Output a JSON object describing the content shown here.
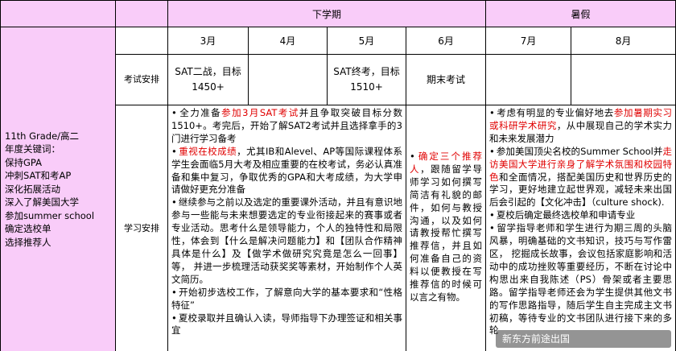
{
  "header": {
    "corner": "",
    "term1": "下学期",
    "term2": "暑假"
  },
  "months": [
    "3月",
    "4月",
    "5月",
    "6月",
    "7月",
    "8月"
  ],
  "row_labels": {
    "exam": "考试安排",
    "study": "学习安排"
  },
  "side": {
    "lines": [
      "11th Grade/高二",
      "年度关键词：",
      "保持GPA",
      "冲刺SAT和考AP",
      "深化拓展活动",
      "深入了解美国大学",
      "参加summer school",
      "确定选校单",
      "选择推荐人"
    ]
  },
  "exam": {
    "march_april": [
      "SAT二战，目标",
      "1450+"
    ],
    "may": [
      "SAT终考，目标",
      "1510+"
    ],
    "june": "期末考试"
  },
  "study": {
    "left": {
      "b1_pre": "全力准备",
      "b1_red": "参加3月SAT考试",
      "b1_post": "并且争取突破目标分数1510+。考完后，开始了解SAT2考试并且选择拿手的3门进行学习备考",
      "b2_red": "重视在校成绩",
      "b2_post": "，尤其IB和Alevel、AP等国际课程体系学生会面临5月大考及相应重要的在校考试，务必认真准备和集中复习，争取优秀的GPA和大考成绩，为大学申请做好更充分准备",
      "b3": "继续参与之前以及选定的重要课外活动，并且有意识地参与一些能与未来想要选定的专业衔接起来的赛事或者专业活动。思考什么是领导能力，个人的独特性和局限性，体会到【什么是解决问题能力】和【团队合作精神具体是什么】及【做学术做研究究竟是怎么一回事】等， 并进一步梳理活动获奖奖等素材，开始制作个人英文简历。",
      "b4": "开始初步选校工作，了解意向大学的基本要求和“性格特征”",
      "b5": "夏校录取并且确认入读，导师指导下办理签证和相关事宜"
    },
    "june": {
      "red": "确定三个推荐人",
      "post": "，跟随留学导师学习如何撰写简洁有礼貌的邮件，如何与教授沟通，以及如何请教授帮忙撰写推荐信，并且如何准备自己的资料以便教授在写推荐信的时候可以言之有物。"
    },
    "summer": {
      "b1_pre": "考虑有明显的专业偏好地去",
      "b1_red": "参加暑期实习或科研学术研究",
      "b1_post": "，从中展现自己的学术实力和未来发展潜力",
      "b2": "参加美国顶尖名校的Summer School并",
      "b2_red": "走访美国大学进行亲身了解学术氛围和校园特色",
      "b2_post": "和全面情况，搭配美国历史和世界历史的学习，更好地建立起世界观，减轻未来出国后会引起的【文化冲击】（culture shock).",
      "b3": "夏校后确定最终选校单和申请专业",
      "b4": "留学指导老师和学生进行为期三周的头脑风暴，明确基础的文书知识，技巧与写作雷区， 挖掘成长故事，会议包括家庭影响和活动中的成功挫败等重要经历，不断在讨论中构思出来自我陈述（PS）骨架或者主要思路。留学指导老师还会为学生提供其他文书的写作思路指导，随后学生自主完成主文书初稿，等待专业的文书团队进行接下来的多轮"
    }
  },
  "watermark": "新东方前途出国"
}
